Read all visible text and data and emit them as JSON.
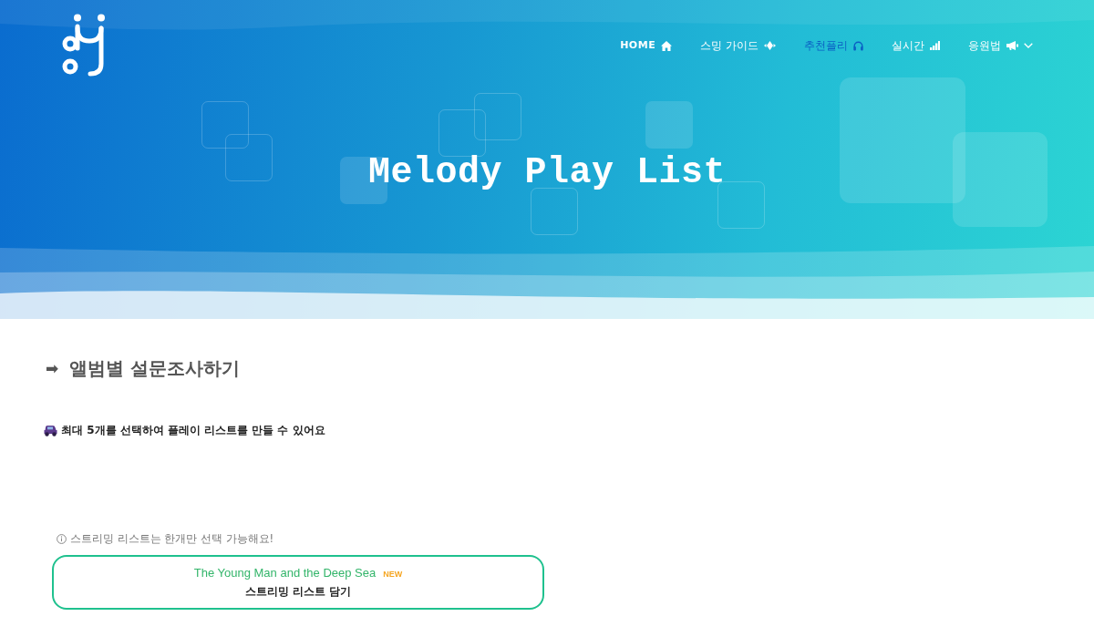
{
  "nav": [
    {
      "label": "HOME",
      "selected": false,
      "has_menu": false
    },
    {
      "label": "스밍 가이드",
      "selected": false,
      "has_menu": false
    },
    {
      "label": "추천플리",
      "selected": true,
      "has_menu": false
    },
    {
      "label": "실시간",
      "selected": false,
      "has_menu": false
    },
    {
      "label": "응원법",
      "selected": false,
      "has_menu": true
    }
  ],
  "hero": {
    "title": "Melody Play List"
  },
  "section": {
    "arrow": "➡",
    "heading": "앨범별 설문조사하기",
    "note": "최대 5개를 선택하여 플레이 리스트를 만들 수 있어요",
    "info": "스트리밍 리스트는 한개만 선택 가능해요!",
    "options": [
      {
        "title": "The Young Man and the Deep Sea",
        "badge": "NEW",
        "action": "스트리밍 리스트 담기"
      }
    ]
  }
}
